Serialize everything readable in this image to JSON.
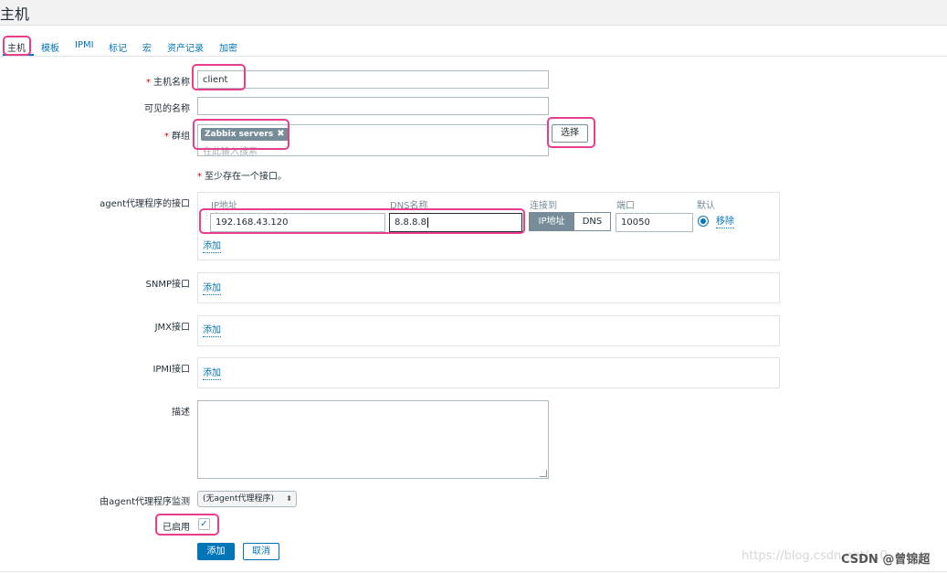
{
  "page_title": "主机",
  "tabs": [
    {
      "label": "主机"
    },
    {
      "label": "模板"
    },
    {
      "label": "IPMI"
    },
    {
      "label": "标记"
    },
    {
      "label": "宏"
    },
    {
      "label": "资产记录"
    },
    {
      "label": "加密"
    }
  ],
  "form": {
    "host_name_label": "主机名称",
    "host_name_value": "client",
    "visible_name_label": "可见的名称",
    "visible_name_value": "",
    "groups_label": "群组",
    "group_tag": "Zabbix servers",
    "group_tag_remove": "✖",
    "groups_placeholder": "在此输入搜索",
    "select_button": "选择",
    "required_star": "*",
    "interface_note": "至少存在一个接口。",
    "agent_label": "agent代理程序的接口",
    "agent_columns": {
      "ip": "IP地址",
      "dns": "DNS名称",
      "connect_to": "连接到",
      "port": "端口",
      "default": "默认"
    },
    "agent_row": {
      "ip": "192.168.43.120",
      "dns": "8.8.8.8",
      "connect_ip": "IP地址",
      "connect_dns": "DNS",
      "port": "10050",
      "remove": "移除"
    },
    "add_link": "添加",
    "snmp_label": "SNMP接口",
    "jmx_label": "JMX接口",
    "ipmi_label": "IPMI接口",
    "description_label": "描述",
    "proxy_label": "由agent代理程序监测",
    "proxy_value": "(无agent代理程序)",
    "enabled_label": "已启用",
    "enabled_check": "✓",
    "submit_button": "添加",
    "cancel_button": "取消"
  },
  "icons": {
    "select_arrows": "⬍"
  },
  "colors": {
    "accent": "#0275b8",
    "highlight": "#e83e8c",
    "required": "#d40000"
  },
  "watermark": {
    "faint": "https://blog.csdn.net/...0",
    "csdn": "CSDN @曾锦超"
  }
}
